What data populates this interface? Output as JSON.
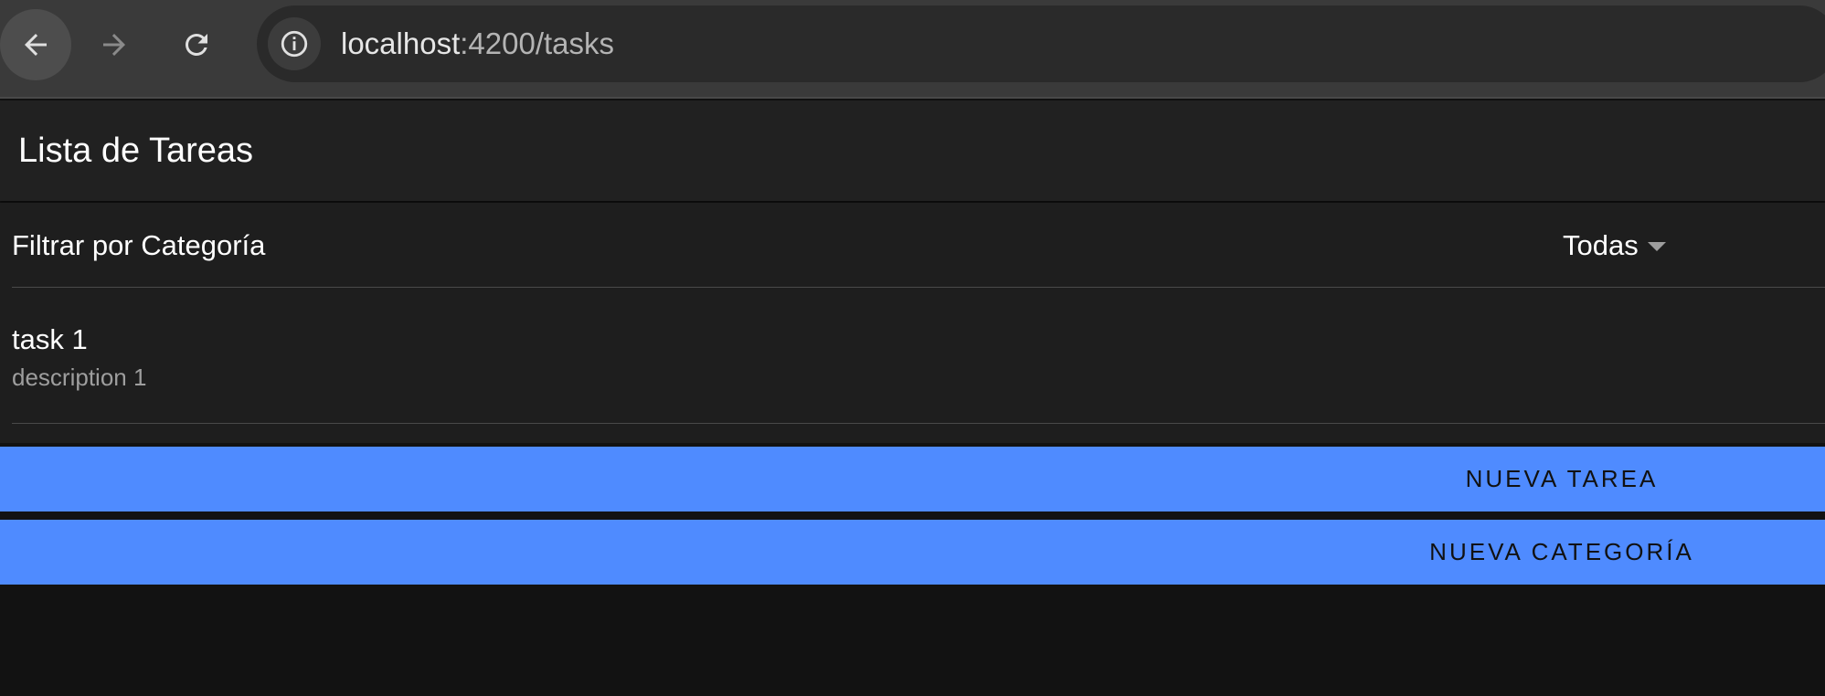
{
  "browser": {
    "url_host": "localhost",
    "url_path": ":4200/tasks",
    "icons": {
      "back": "arrow-left-icon",
      "forward": "arrow-right-icon",
      "reload": "reload-icon",
      "site_info": "info-icon"
    }
  },
  "header": {
    "title": "Lista de Tareas"
  },
  "filter": {
    "label": "Filtrar por Categoría",
    "selected": "Todas"
  },
  "tasks": [
    {
      "title": "task 1",
      "description": "description 1"
    }
  ],
  "actions": {
    "new_task": "NUEVA TAREA",
    "new_category": "NUEVA CATEGORÍA"
  },
  "colors": {
    "accent": "#4f8bff",
    "background": "#121212",
    "surface": "#1e1e1e"
  }
}
